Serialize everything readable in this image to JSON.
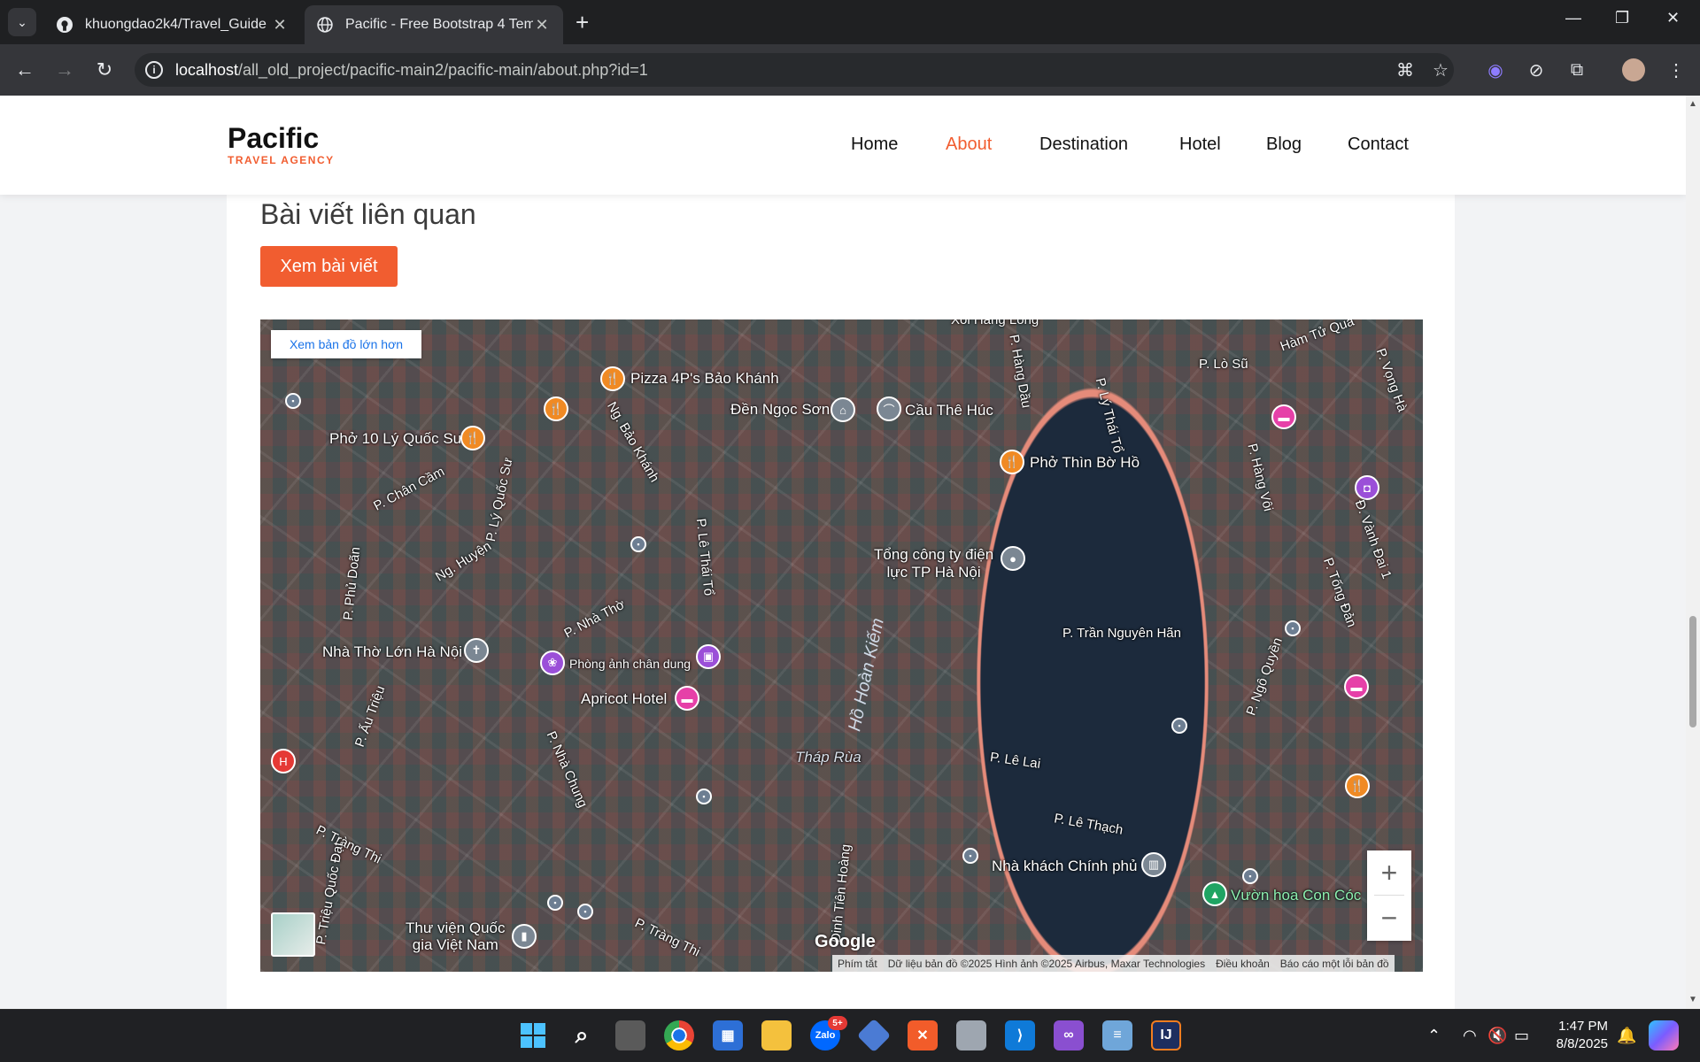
{
  "browser": {
    "tabs": [
      {
        "title": "khuongdao2k4/Travel_Guide",
        "active": false
      },
      {
        "title": "Pacific - Free Bootstrap 4 Temp",
        "active": true
      }
    ],
    "url_host": "localhost",
    "url_path": "/all_old_project/pacific-main2/pacific-main/about.php?id=1"
  },
  "site": {
    "logo": "Pacific",
    "logo_sub": "TRAVEL AGENCY",
    "nav": [
      "Home",
      "About",
      "Destination",
      "Hotel",
      "Blog",
      "Contact"
    ],
    "active_nav": "About",
    "accent_color": "#f15d30"
  },
  "related": {
    "title": "Bài viết liên quan",
    "button": "Xem bài viết"
  },
  "map": {
    "view_larger": "Xem bản đồ lớn hơn",
    "lake_name": "Hồ Hoàn Kiếm",
    "places": {
      "pizza": "Pizza 4P's Bảo Khánh",
      "den": "Đền Ngọc Sơn",
      "cau": "Cầu Thê Húc",
      "pho10": "Phở 10 Lý Quốc Sư",
      "phothin": "Phở Thìn Bờ Hồ",
      "tongcty": "Tổng công ty điện\nlực TP Hà Nội",
      "nhatho": "Nhà Thờ Lớn Hà Nội",
      "phonganh": "Phòng ảnh chân dung",
      "apricot": "Apricot Hotel",
      "thaprua": "Tháp Rùa",
      "nhakhach": "Nhà khách Chính phủ",
      "vuonhoa": "Vườn hoa Con Cóc",
      "thuvien": "Thư viện Quốc\ngia Việt Nam",
      "xoi": "Xôi Hàng Lòng"
    },
    "streets": {
      "loSu": "P. Lò Sũ",
      "hamTu": "Hàm Tử Qua",
      "hangDau": "P. Hàng Dầu",
      "lyThaiTo": "P. Lý Thái Tổ",
      "chanCam": "P. Chân Cầm",
      "lyQuocSu": "P. Lý Quốc Sư",
      "ngBaoKhanh": "Ng. Bảo Khánh",
      "phuDoan": "P. Phủ Doãn",
      "ngHuyen": "Ng. Huyện",
      "nhaTho": "P. Nhà Thờ",
      "leThaiTo": "P. Lê Thái Tổ",
      "tranNguyenHan": "P. Trần Nguyên Hãn",
      "ngoQuyen": "P. Ngô Quyền",
      "tongDan": "P. Tống Đản",
      "leLai": "P. Lê Lai",
      "leThach": "P. Lê Thạch",
      "auTrieu": "P. Ấu Triệu",
      "nhaChung": "P. Nhà Chung",
      "trangThi": "P. Tràng Thi",
      "trieuQuocDat": "P. Triệu Quốc Đạt",
      "dinhTienHoang": "Đinh Tiên Hoàng",
      "hangVoi": "P. Hàng Vôi",
      "vanhDai1": "Đ. Vành Đai 1",
      "vongHa": "P. Vọng Hà"
    },
    "zoom_in": "+",
    "zoom_out": "−",
    "google": "Google",
    "attribution": [
      "Phím tắt",
      "Dữ liệu bản đồ ©2025 Hình ảnh ©2025 Airbus, Maxar Technologies",
      "Điều khoản",
      "Báo cáo một lỗi bản đồ"
    ]
  },
  "taskbar": {
    "time": "1:47 PM",
    "date": "8/8/2025",
    "zalo_badge": "5+"
  }
}
